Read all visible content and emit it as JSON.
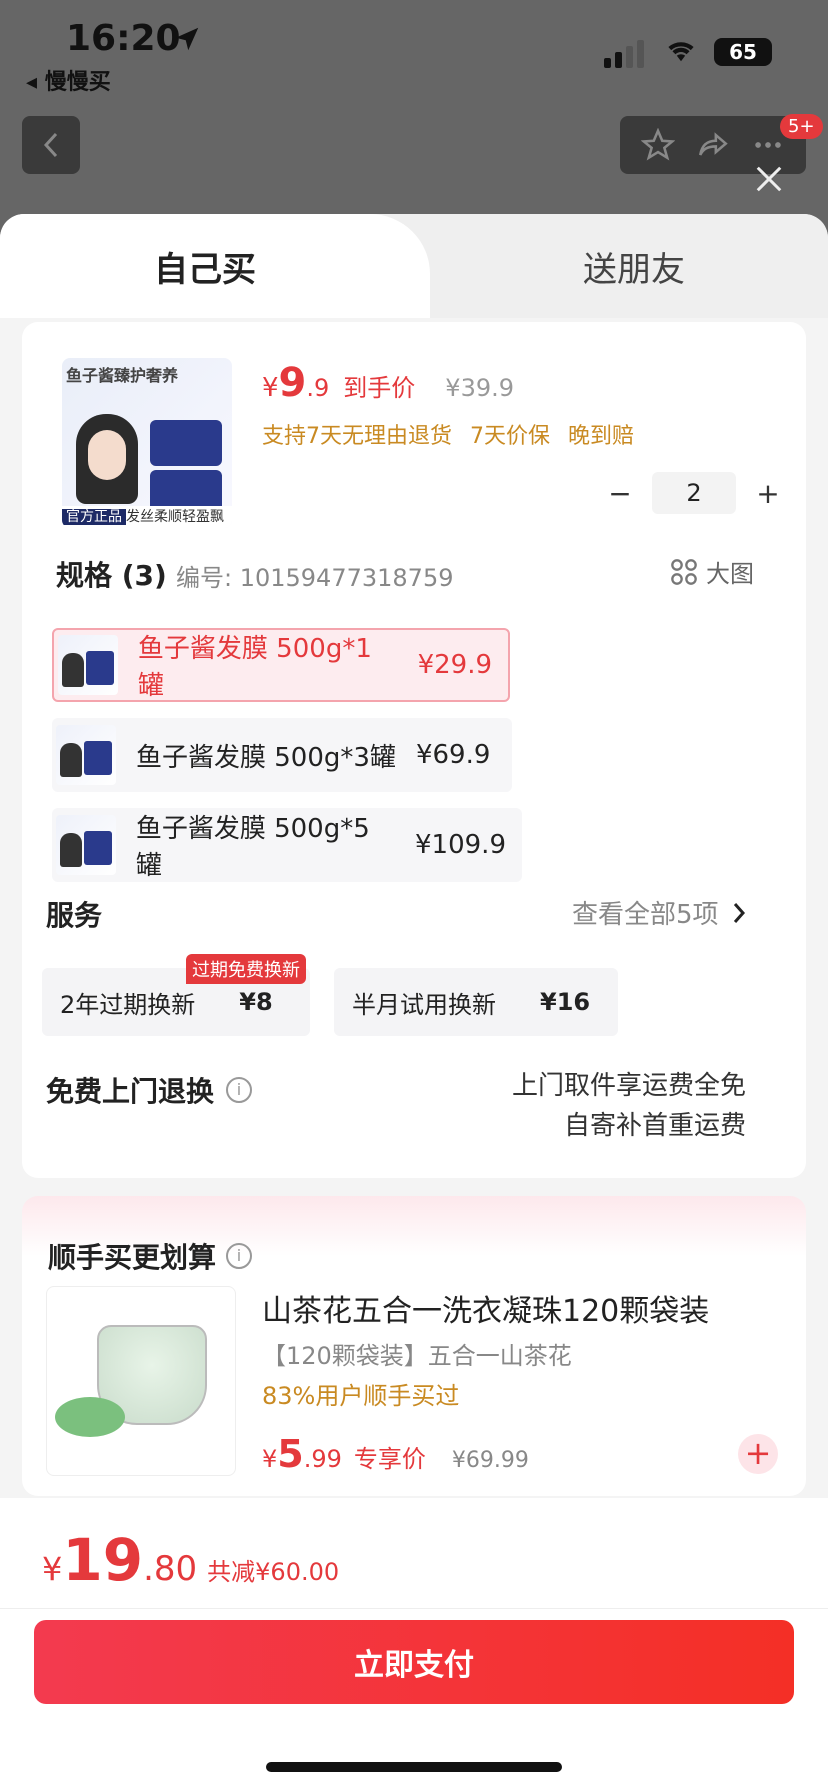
{
  "status_bar": {
    "time": "16:20",
    "back_app": "◂ 慢慢买",
    "battery": "65"
  },
  "nav": {
    "badge": "5+"
  },
  "tabs": [
    {
      "label": "自己买"
    },
    {
      "label": "送朋友"
    }
  ],
  "product": {
    "image_title": "鱼子酱臻护奢养",
    "image_official": "官方正品",
    "image_caption": "发丝柔顺轻盈飘逸",
    "price_symbol": "¥",
    "price_int": "9",
    "price_dec": ".9",
    "price_label": "到手价",
    "original_price": "¥39.9",
    "guarantees": [
      "支持7天无理由退货",
      "7天价保",
      "晚到赔"
    ],
    "quantity": "2",
    "minus": "−",
    "plus": "+"
  },
  "spec": {
    "title": "规格 (3)",
    "code": "编号: 10159477318759",
    "big_image": "大图",
    "items": [
      {
        "name": "鱼子酱发膜 500g*1罐",
        "price": "¥29.9",
        "selected": true
      },
      {
        "name": "鱼子酱发膜 500g*3罐",
        "price": "¥69.9",
        "selected": false
      },
      {
        "name": "鱼子酱发膜 500g*5罐",
        "price": "¥109.9",
        "selected": false
      }
    ]
  },
  "services": {
    "title": "服务",
    "view_all": "查看全部5项",
    "tag": "过期免费换新",
    "items": [
      {
        "name": "2年过期换新",
        "price": "¥8"
      },
      {
        "name": "半月试用换新",
        "price": "¥16"
      }
    ]
  },
  "free_return": {
    "title": "免费上门退换",
    "line1": "上门取件享运费全免",
    "line2": "自寄补首重运费"
  },
  "addon": {
    "title": "顺手买更划算",
    "name": "山茶花五合一洗衣凝珠120颗袋装",
    "sub": "【120颗袋装】五合一山茶花",
    "rate": "83%用户顺手买过",
    "price_symbol": "¥",
    "price_int": "5",
    "price_dec": ".99",
    "price_label": "专享价",
    "original_price": "¥69.99"
  },
  "footer": {
    "price_symbol": "¥",
    "price_int": "19",
    "price_dec": ".80",
    "reduce": "共减¥60.00",
    "pay": "立即支付"
  },
  "colors": {
    "accent": "#e4393c",
    "gold": "#c98a22"
  }
}
